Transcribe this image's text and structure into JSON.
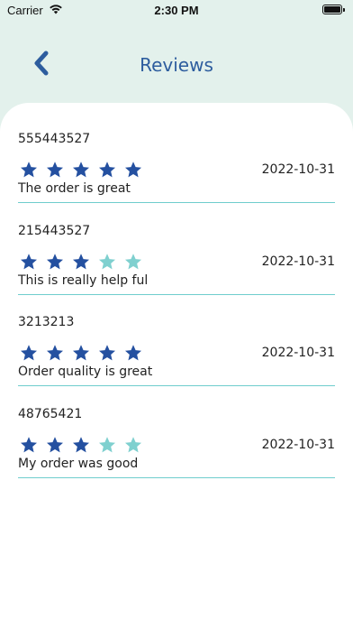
{
  "status_bar": {
    "carrier": "Carrier",
    "time": "2:30 PM"
  },
  "header": {
    "title": "Reviews",
    "back_icon": "chevron-left-icon"
  },
  "colors": {
    "star_filled": "#2450a0",
    "star_empty": "#7fd0cf",
    "divider": "#6fcdcd",
    "accent": "#2d5d9e"
  },
  "reviews": [
    {
      "id": "555443527",
      "rating": 5,
      "date": "2022-10-31",
      "comment": "The order is great"
    },
    {
      "id": "215443527",
      "rating": 3,
      "date": "2022-10-31",
      "comment": "This is really help ful"
    },
    {
      "id": "3213213",
      "rating": 5,
      "date": "2022-10-31",
      "comment": "Order quality is great"
    },
    {
      "id": "48765421",
      "rating": 3,
      "date": "2022-10-31",
      "comment": "My order was good"
    }
  ]
}
